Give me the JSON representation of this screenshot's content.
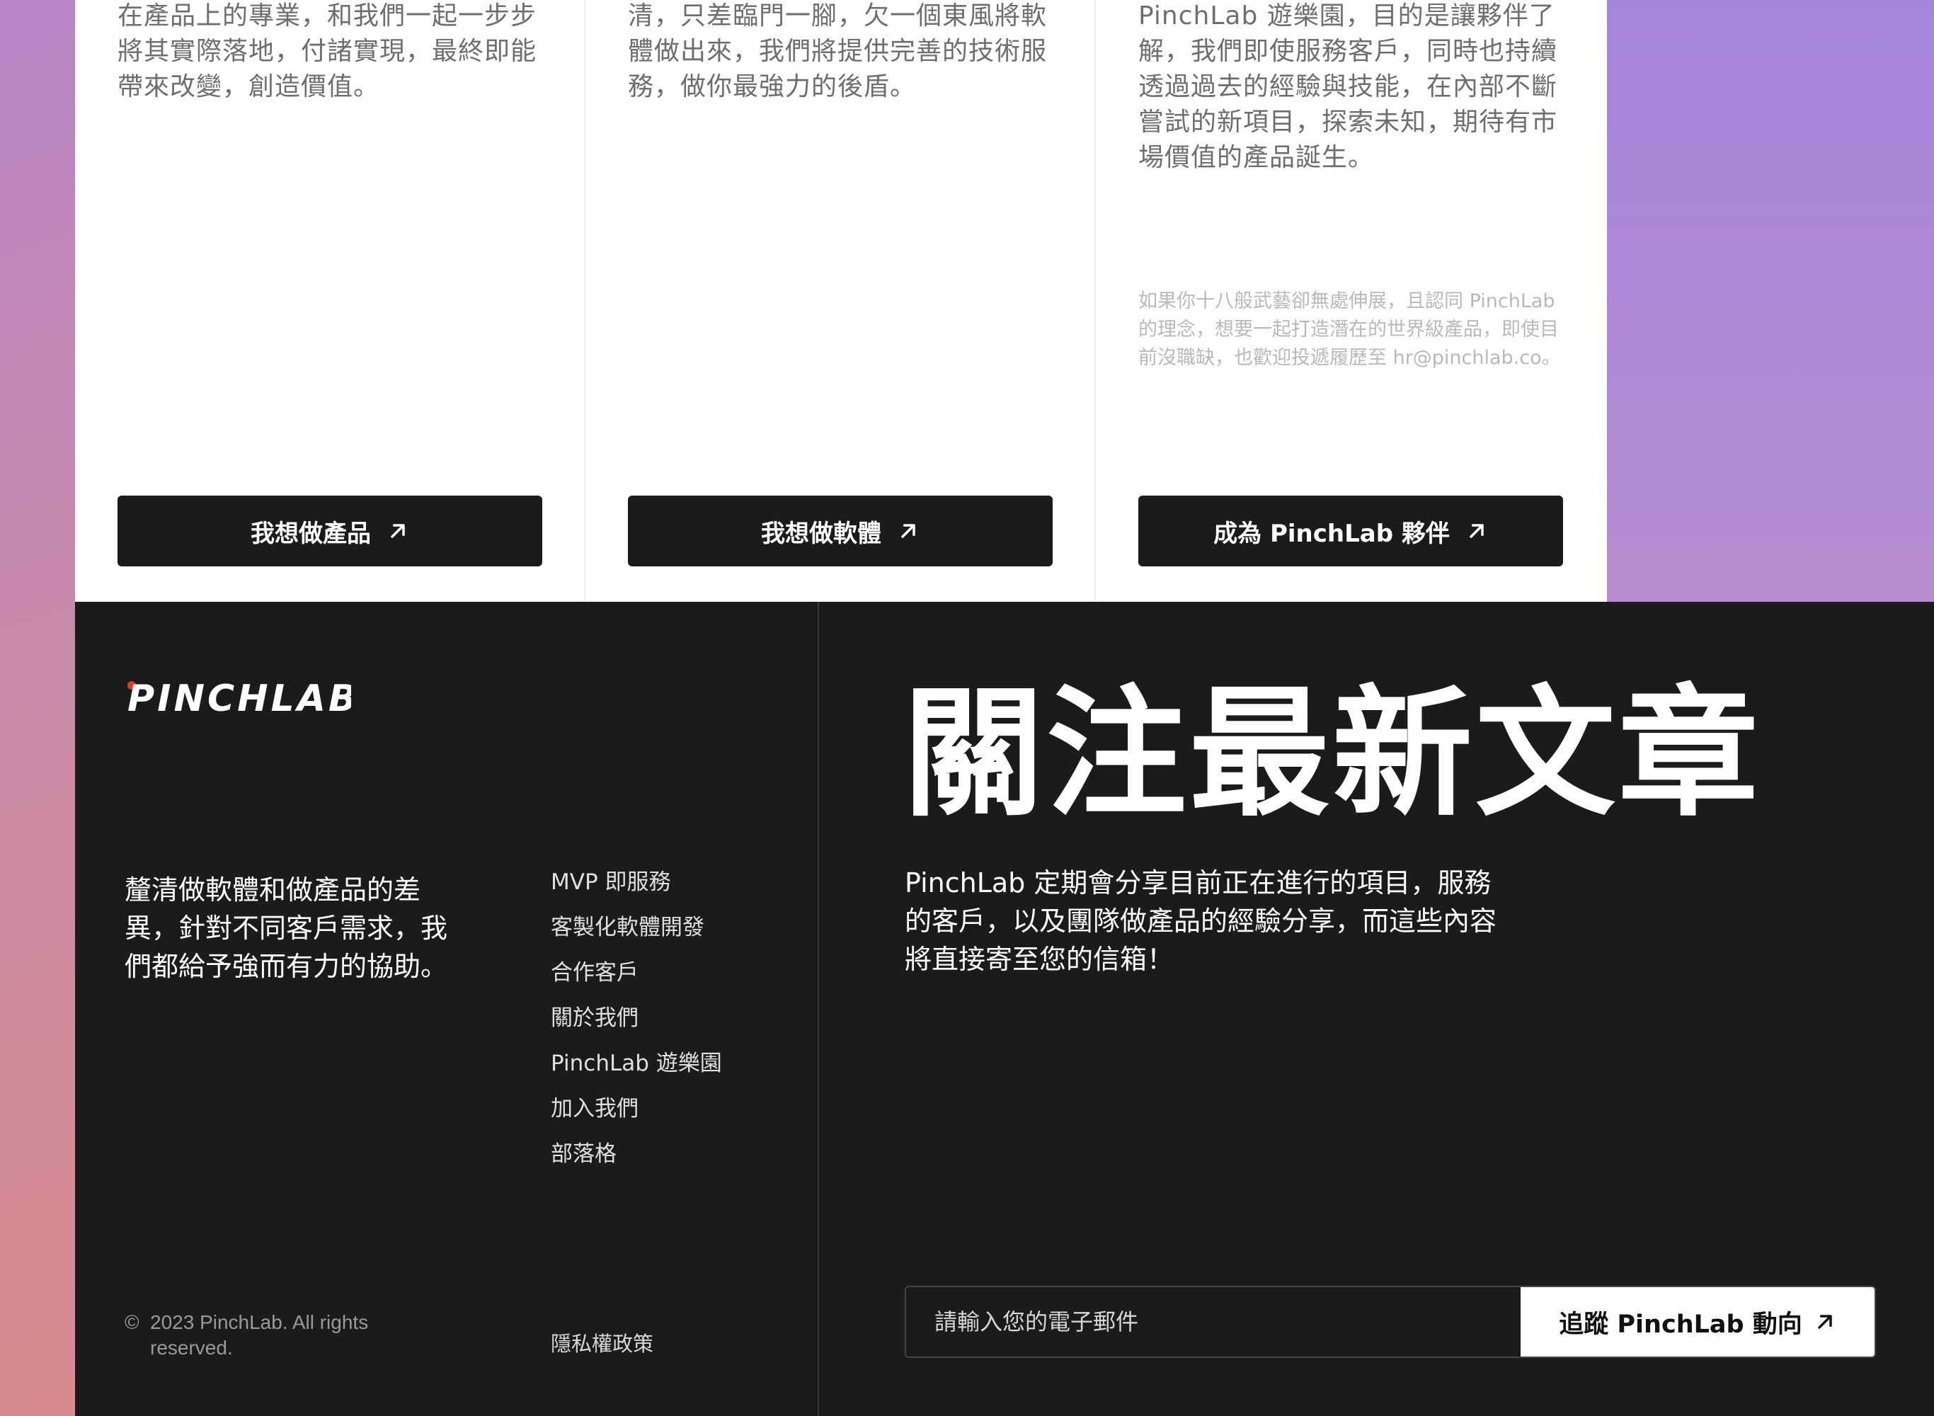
{
  "cards": [
    {
      "text": "于市場潛在機會，相信只要透過我們在產品上的專業，和我們一起一步步將其實際落地，付諸實現，最終即能帶來改變，創造價值。",
      "note": "",
      "button_label": "我想做產品"
    },
    {
      "text": "眾，以及要執行的內容你都已經釐清，只差臨門一腳，欠一個東風將軟體做出來，我們將提供完善的技術服務，做你最強力的後盾。",
      "note": "",
      "button_label": "我想做軟體"
    },
    {
      "text": "品並非不可能的任務。設立 PinchLab 遊樂園，目的是讓夥伴了解，我們即使服務客戶，同時也持續透過過去的經驗與技能，在內部不斷嘗試的新項目，探索未知，期待有市場價值的產品誕生。",
      "note": "如果你十八般武藝卻無處伸展，且認同 PinchLab 的理念，想要一起打造潛在的世界級產品，即使目前沒職缺，也歡迎投遞履歷至 hr@pinchlab.co。",
      "button_label": "成為 PinchLab 夥伴"
    }
  ],
  "footer": {
    "logo_text": "PINCHLAB",
    "tagline": "釐清做軟體和做產品的差異，針對不同客戶需求，我們都給予強而有力的協助。",
    "nav": [
      "MVP 即服務",
      "客製化軟體開發",
      "合作客戶",
      "關於我們",
      "PinchLab 遊樂園",
      "加入我們",
      "部落格"
    ],
    "copyright_mark": "©",
    "copyright": "2023 PinchLab. All rights reserved.",
    "privacy": "隱私權政策"
  },
  "newsletter": {
    "title": "關注最新文章",
    "description": "PinchLab 定期會分享目前正在進行的項目，服務的客戶，以及團隊做產品的經驗分享，而這些內容將直接寄至您的信箱！",
    "placeholder": "請輸入您的電子郵件",
    "button_label": "追蹤 PinchLab 動向"
  },
  "icons": {
    "arrow": "arrow-up-right-icon"
  },
  "colors": {
    "footer_bg": "#1b1b1b",
    "button_bg": "#1b1b1b",
    "logo_accent": "#e0392b"
  }
}
